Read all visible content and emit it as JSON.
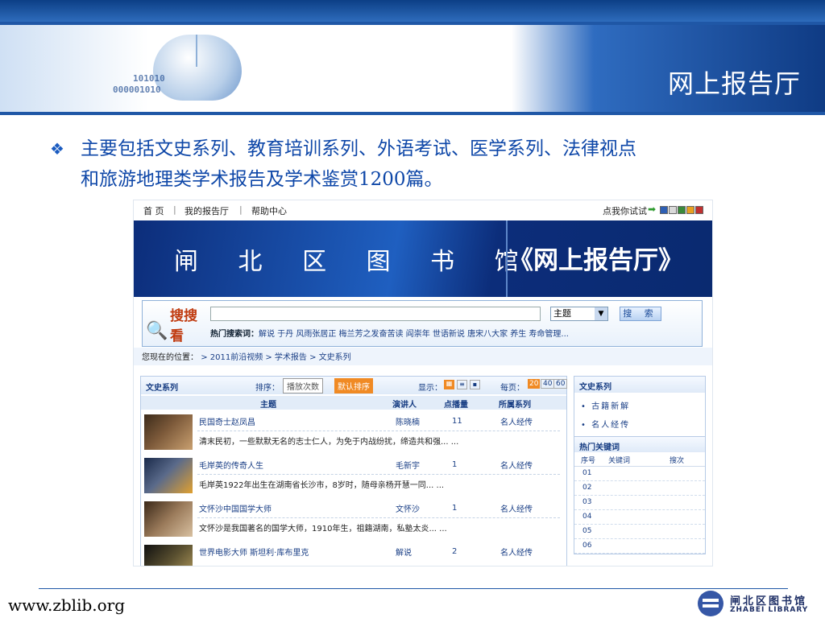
{
  "slide": {
    "title": "网上报告厅",
    "bullet_line1": "主要包括文史系列、教育培训系列、外语考试、医学系列、法律视点",
    "bullet_line2": "和旅游地理类学术报告及学术鉴赏1200篇。",
    "bullet_icon": "diamond-bullet-icon",
    "header_binary_1": "101010",
    "header_binary_2": "000001010",
    "footer_url": "www.zblib.org",
    "footer_logo_cn": "闸北区图书馆",
    "footer_logo_en": "ZHABEI LIBRARY"
  },
  "site": {
    "nav": {
      "home": "首 页",
      "sep1": "|",
      "my": "我的报告厅",
      "sep2": "|",
      "help": "帮助中心",
      "try": "点我你试试"
    },
    "swatches": [
      "#2e5fb3",
      "#d9d9d9",
      "#3a8a3a",
      "#e8a020",
      "#c03030"
    ],
    "banner_left": "闸 北 区 图 书 馆",
    "banner_right": "《网上报告厅》",
    "search": {
      "logo": "搜搜看",
      "select_value": "主题",
      "button": "搜 索",
      "hot_label": "热门搜索词：",
      "hot_terms": "解说  于丹  风雨张居正  梅兰芳之发奋苦读  阎崇年  世语新说  唐宋八大家  养生  寿命管理..."
    },
    "crumb": {
      "label": "您现在的位置：",
      "path": "> 2011前沿视频 > 学术报告 > 文史系列"
    },
    "list": {
      "title": "文史系列",
      "sort_label": "排序：",
      "sort_opt1": "播放次数",
      "sort_opt2": "默认排序",
      "display_label": "显示：",
      "perpage_label": "每页：",
      "perpage": [
        "20",
        "40",
        "60"
      ],
      "headers": {
        "topic": "主题",
        "speaker": "演讲人",
        "plays": "点播量",
        "series": "所属系列"
      },
      "rows": [
        {
          "title": "民国奇士赵凤昌",
          "speaker": "陈晓楠",
          "plays": "11",
          "series": "名人经传",
          "desc": "清末民初，一些默默无名的志士仁人，为免于内战纷扰，缔造共和强... ..."
        },
        {
          "title": "毛岸英的传奇人生",
          "speaker": "毛新宇",
          "plays": "1",
          "series": "名人经传",
          "desc": "毛岸英1922年出生在湖南省长沙市，8岁时，随母亲杨开慧一同... ..."
        },
        {
          "title": "文怀沙中国国学大师",
          "speaker": "文怀沙",
          "plays": "1",
          "series": "名人经传",
          "desc": "文怀沙是我国著名的国学大师，1910年生，祖籍湖南，私塾太炎... ..."
        },
        {
          "title": "世界电影大师 斯坦利·库布里克",
          "speaker": "解说",
          "plays": "2",
          "series": "名人经传",
          "desc": ""
        }
      ]
    },
    "side": {
      "series_title": "文史系列",
      "series_items": [
        "古籍新解",
        "名人经传"
      ],
      "kw_title": "热门关键词",
      "kw_headers": {
        "no": "序号",
        "kw": "关键词",
        "count": "搜次"
      },
      "kw_rows": [
        "01",
        "02",
        "03",
        "04",
        "05",
        "06"
      ]
    }
  }
}
